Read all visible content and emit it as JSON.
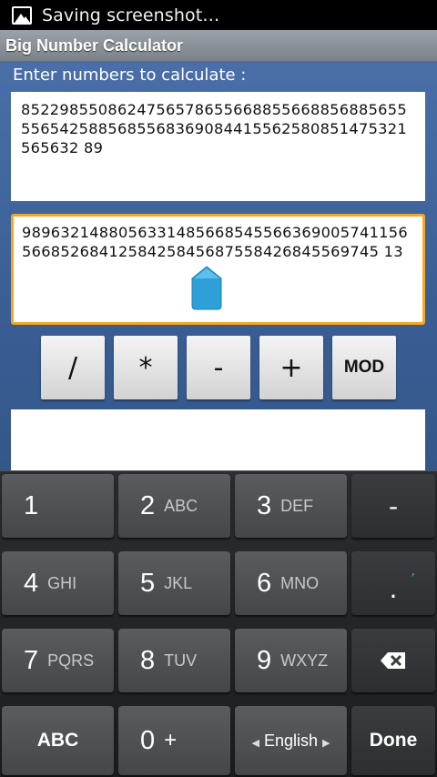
{
  "status_bar": {
    "text": "Saving screenshot…",
    "icon": "image-icon"
  },
  "title_bar": {
    "title": "Big Number Calculator"
  },
  "form": {
    "prompt": "Enter numbers to calculate :",
    "first_number": "85229855086247565786556688556688568856555565425885685568369084415562580851475321565632 89",
    "second_number": "98963214880563314856685455663690057411565668526841258425845687558426845569745 13",
    "result": ""
  },
  "operators": [
    "/",
    "*",
    "-",
    "+",
    "MOD"
  ],
  "keyboard": {
    "rows": [
      [
        {
          "main": "1",
          "sub": ""
        },
        {
          "main": "2",
          "sub": "ABC"
        },
        {
          "main": "3",
          "sub": "DEF"
        },
        {
          "main": "-",
          "sub": ""
        }
      ],
      [
        {
          "main": "4",
          "sub": "GHI"
        },
        {
          "main": "5",
          "sub": "JKL"
        },
        {
          "main": "6",
          "sub": "MNO"
        },
        {
          "main": ".",
          "sub": ","
        }
      ],
      [
        {
          "main": "7",
          "sub": "PQRS"
        },
        {
          "main": "8",
          "sub": "TUV"
        },
        {
          "main": "9",
          "sub": "WXYZ"
        },
        {
          "main": "backspace",
          "sub": ""
        }
      ],
      [
        {
          "main": "ABC",
          "sub": ""
        },
        {
          "main": "0",
          "sub": "+"
        },
        {
          "main": "English",
          "sub": ""
        },
        {
          "main": "Done",
          "sub": ""
        }
      ]
    ]
  },
  "colors": {
    "accent_focus": "#f5a623",
    "cursor_handle": "#33a3dc"
  }
}
